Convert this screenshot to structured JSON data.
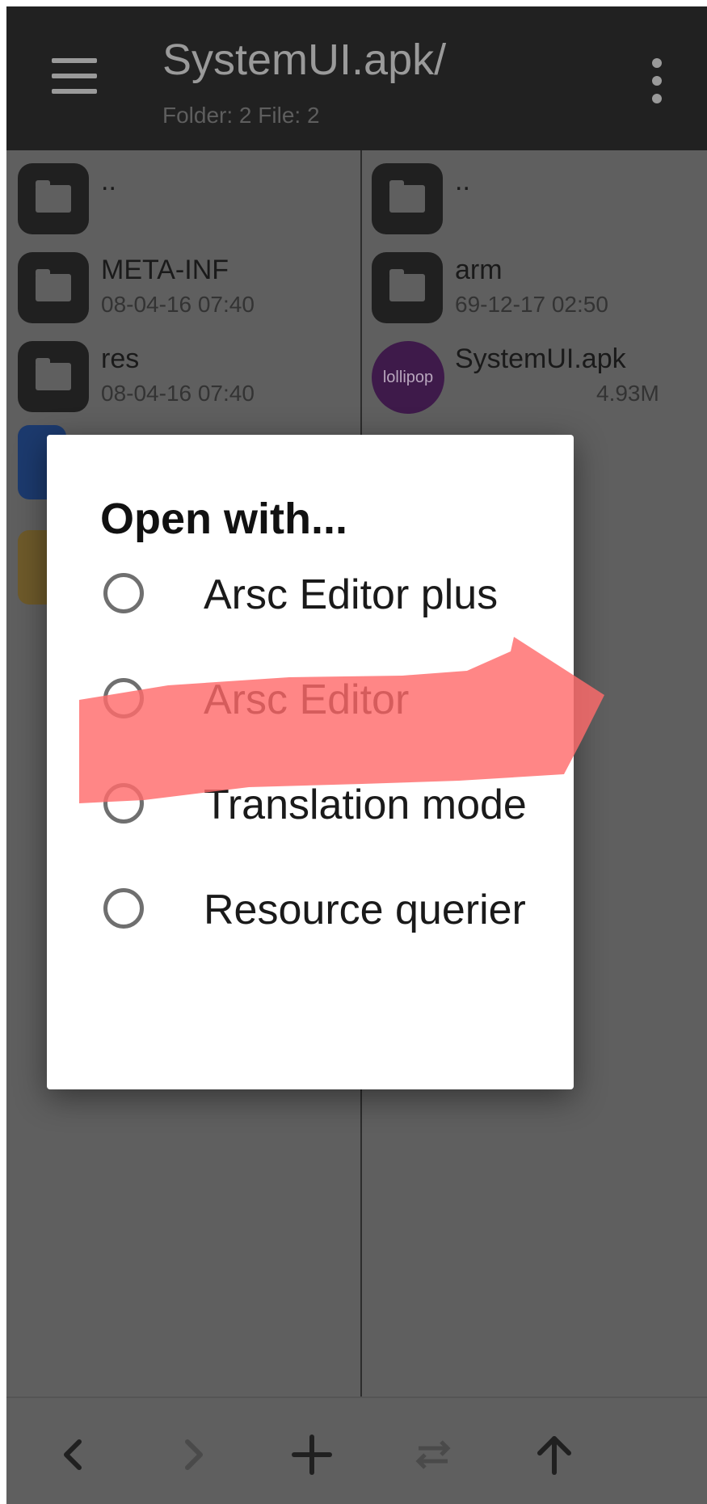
{
  "header": {
    "title": "SystemUI.apk/",
    "subtitle": "Folder: 2  File: 2",
    "menu_icon": "hamburger-menu-icon",
    "more_icon": "more-vert-icon"
  },
  "left_pane": {
    "items": [
      {
        "name": "..",
        "meta": ""
      },
      {
        "name": "META-INF",
        "meta": "08-04-16 07:40"
      },
      {
        "name": "res",
        "meta": "08-04-16 07:40"
      }
    ]
  },
  "right_pane": {
    "items": [
      {
        "name": "..",
        "meta": ""
      },
      {
        "name": "arm",
        "meta": "69-12-17 02:50"
      },
      {
        "name": "SystemUI.apk",
        "meta": "",
        "icon_text": "lollipop",
        "size": "4.93M"
      }
    ]
  },
  "dialog": {
    "title": "Open with...",
    "options": [
      {
        "label": "Arsc Editor plus",
        "selected": false
      },
      {
        "label": "Arsc Editor",
        "selected": false
      },
      {
        "label": "Translation mode",
        "selected": false
      },
      {
        "label": "Resource querier",
        "selected": false
      }
    ]
  },
  "bottom_bar": {
    "buttons": [
      "back-icon",
      "forward-icon",
      "add-icon",
      "swap-icon",
      "up-icon"
    ]
  },
  "colors": {
    "appbar": "#212121",
    "pane_dimmed": "#5f5f5f",
    "dialog": "#ffffff",
    "highlight": "#ff6b6b"
  }
}
